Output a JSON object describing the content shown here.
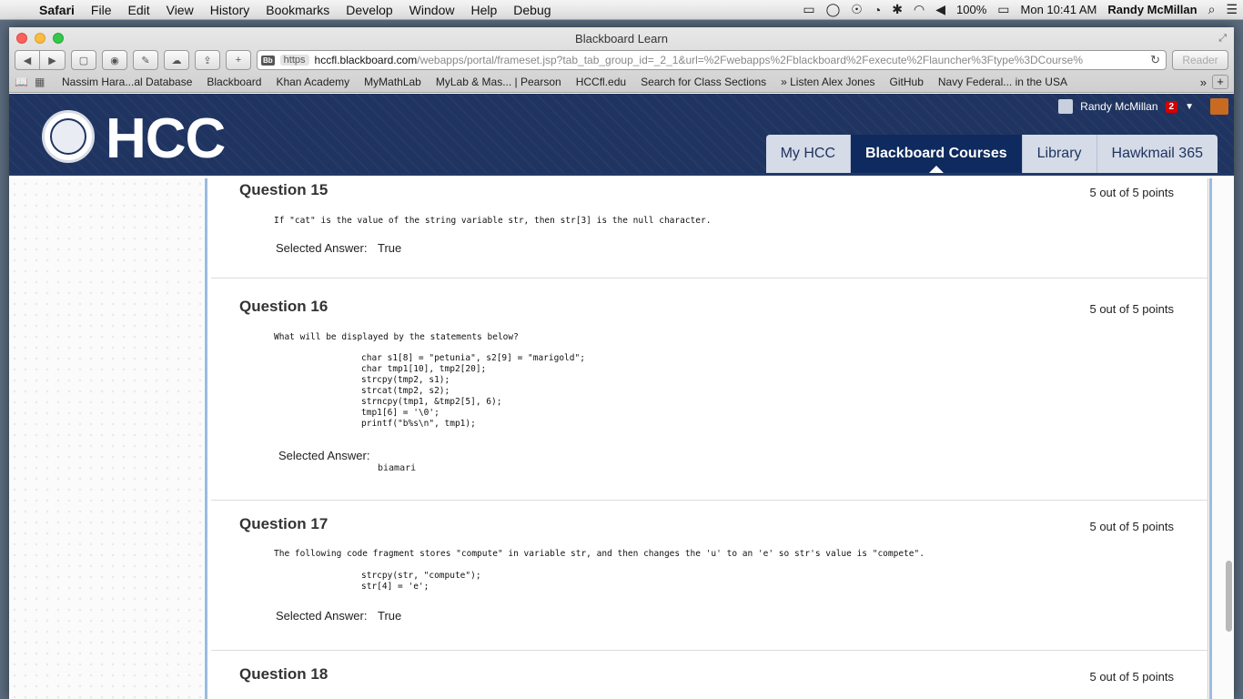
{
  "menubar": {
    "app": "Safari",
    "items": [
      "File",
      "Edit",
      "View",
      "History",
      "Bookmarks",
      "Develop",
      "Window",
      "Help",
      "Debug"
    ],
    "battery": "100%",
    "clock": "Mon 10:41 AM",
    "user": "Randy McMillan"
  },
  "window": {
    "title": "Blackboard Learn",
    "url_scheme": "https",
    "url_domain": "hccfl.blackboard.com",
    "url_path": "/webapps/portal/frameset.jsp?tab_tab_group_id=_2_1&url=%2Fwebapps%2Fblackboard%2Fexecute%2Flauncher%3Ftype%3DCourse%",
    "reader_label": "Reader"
  },
  "bookmarks": [
    "Nassim Hara...al Database",
    "Blackboard",
    "Khan Academy",
    "MyMathLab",
    "MyLab & Mas... | Pearson",
    "HCCfl.edu",
    "Search for Class Sections",
    "» Listen Alex Jones",
    "GitHub",
    "Navy Federal... in the USA"
  ],
  "header": {
    "logo_text": "HCC",
    "user_name": "Randy McMillan",
    "notifications": "2",
    "tabs": [
      "My HCC",
      "Blackboard Courses",
      "Library",
      "Hawkmail 365"
    ],
    "active_tab": "Blackboard Courses"
  },
  "questions": [
    {
      "title": "Question 15",
      "points": "5 out of 5 points",
      "text": "If \"cat\" is the value of the string variable str, then str[3] is the null character.",
      "selected_label": "Selected Answer:",
      "selected_answer": "True"
    },
    {
      "title": "Question 16",
      "points": "5 out of 5 points",
      "text": "What will be displayed by the statements below?",
      "code": [
        "char s1[8] = \"petunia\", s2[9] = \"marigold\";",
        "char tmp1[10], tmp2[20];",
        "strcpy(tmp2, s1);",
        "strcat(tmp2, s2);",
        "strncpy(tmp1, &tmp2[5], 6);",
        "tmp1[6] = '\\0';",
        "printf(\"b%s\\n\", tmp1);"
      ],
      "selected_label": "Selected Answer:",
      "selected_answer": "biamari"
    },
    {
      "title": "Question 17",
      "points": "5 out of 5 points",
      "text": "The following code fragment stores \"compute\" in variable str, and then changes the 'u' to an 'e' so str's value is \"compete\".",
      "code": [
        "strcpy(str, \"compute\");",
        "str[4] = 'e';"
      ],
      "selected_label": "Selected Answer:",
      "selected_answer": "True"
    },
    {
      "title": "Question 18",
      "points": "5 out of 5 points"
    }
  ]
}
